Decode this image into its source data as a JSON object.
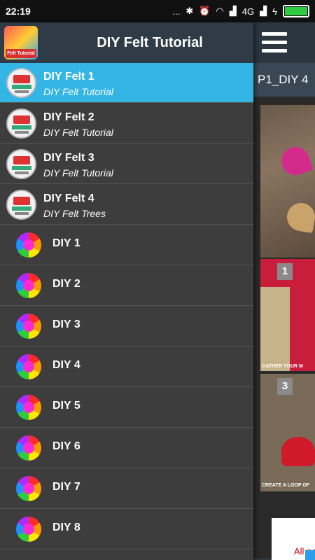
{
  "status_bar": {
    "time": "22:19",
    "network": "4G",
    "dots": "..."
  },
  "drawer": {
    "title": "DIY Felt Tutorial",
    "logo_label": "Felt Tutorial",
    "items": [
      {
        "title": "DIY Felt 1",
        "subtitle": "DIY Felt Tutorial",
        "active": true
      },
      {
        "title": "DIY Felt 2",
        "subtitle": "DIY Felt Tutorial"
      },
      {
        "title": "DIY Felt 3",
        "subtitle": "DIY Felt Tutorial"
      },
      {
        "title": "DIY Felt 4",
        "subtitle": "DIY Felt Trees"
      }
    ],
    "diy_items": [
      "DIY 1",
      "DIY 2",
      "DIY 3",
      "DIY 4",
      "DIY 5",
      "DIY 6",
      "DIY 7",
      "DIY 8"
    ]
  },
  "background": {
    "tab_label": "P1_DIY 4",
    "step1_badge": "1",
    "step3_badge": "3",
    "caption1": "GATHER YOUR M",
    "caption3": "CREATE A LOOP OF",
    "ad_text": "All ne"
  },
  "colors": {
    "accent": "#33b5e5",
    "header": "#2f3b47",
    "drawer_bg": "#3d3d3d"
  }
}
